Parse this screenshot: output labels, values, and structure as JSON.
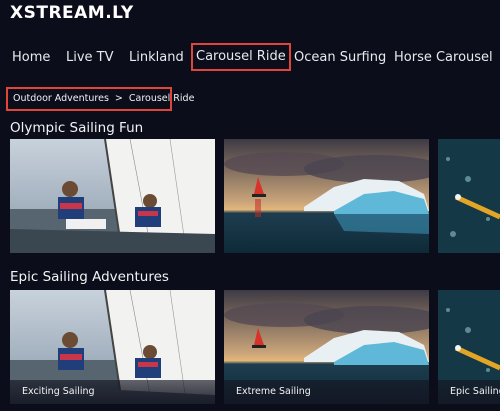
{
  "app": {
    "logo": "XSTREAM.LY"
  },
  "nav": {
    "items": [
      {
        "label": "Home"
      },
      {
        "label": "Live TV"
      },
      {
        "label": "Linkland"
      },
      {
        "label": "Carousel Ride",
        "active": true
      },
      {
        "label": "Ocean Surfing"
      },
      {
        "label": "Horse Carousel"
      }
    ]
  },
  "breadcrumb": {
    "items": [
      "Outdoor Adventures",
      "Carousel Ride"
    ],
    "separator": ">"
  },
  "rows": [
    {
      "title": "Olympic Sailing Fun",
      "tiles": [
        {
          "image": "sailing-dinghy-image",
          "caption": ""
        },
        {
          "image": "iceberg-sailboat-image",
          "caption": ""
        },
        {
          "image": "ocean-kayak-image",
          "caption": ""
        }
      ]
    },
    {
      "title": "Epic Sailing Adventures",
      "tiles": [
        {
          "image": "sailing-dinghy-image",
          "caption": "Exciting Sailing"
        },
        {
          "image": "iceberg-sailboat-image",
          "caption": "Extreme Sailing"
        },
        {
          "image": "ocean-kayak-image",
          "caption": "Epic Sailing"
        }
      ]
    }
  ],
  "colors": {
    "background": "#0b0d1a",
    "highlight": "#e0453c"
  }
}
